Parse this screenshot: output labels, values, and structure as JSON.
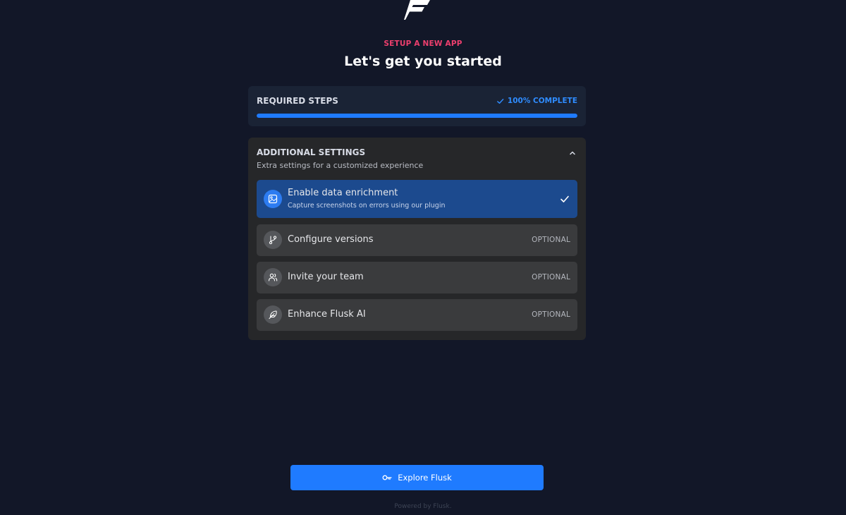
{
  "header": {
    "logo_icon": "flusk-logo-icon",
    "eyebrow": "SETUP A NEW APP",
    "title": "Let's get you started"
  },
  "required_steps": {
    "label": "REQUIRED STEPS",
    "status": "100% COMPLETE",
    "progress_percent": 100,
    "status_icon": "check-icon"
  },
  "additional_settings": {
    "title": "ADDITIONAL SETTINGS",
    "subtitle": "Extra settings for a customized experience",
    "collapse_icon": "chevron-up-icon",
    "items": [
      {
        "label": "Enable data enrichment",
        "description": "Capture screenshots on errors using our plugin",
        "icon": "image-icon",
        "state": "checked"
      },
      {
        "label": "Configure versions",
        "tag": "OPTIONAL",
        "icon": "git-branch-icon"
      },
      {
        "label": "Invite your team",
        "tag": "OPTIONAL",
        "icon": "users-icon"
      },
      {
        "label": "Enhance Flusk AI",
        "tag": "OPTIONAL",
        "icon": "feather-icon"
      }
    ]
  },
  "cta": {
    "label": "Explore Flusk",
    "icon": "key-icon"
  },
  "footer": {
    "text": "Powered by Flusk."
  },
  "colors": {
    "background": "#121728",
    "accent": "#1f7bff",
    "eyebrow": "#ee3f6e",
    "active_item": "#1c4a8e"
  }
}
